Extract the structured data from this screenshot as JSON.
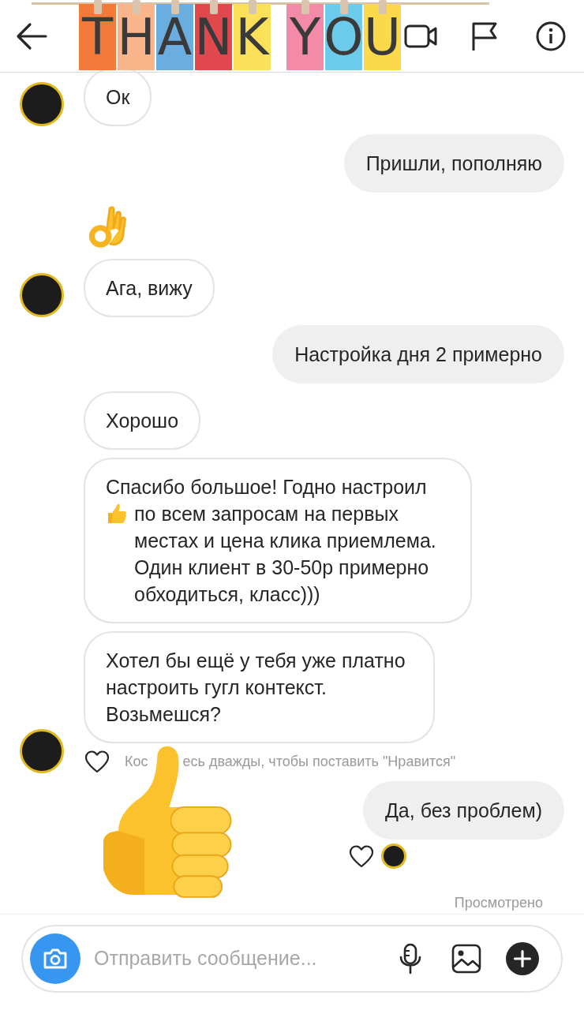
{
  "header": {
    "banner": {
      "letters": [
        {
          "char": "T",
          "color": "#f47a3a"
        },
        {
          "char": "H",
          "color": "#fbb58a"
        },
        {
          "char": "A",
          "color": "#6aaee0"
        },
        {
          "char": "N",
          "color": "#e0484e"
        },
        {
          "char": "K",
          "color": "#fbe15a"
        },
        {
          "char": "Y",
          "color": "#f38aa8"
        },
        {
          "char": "O",
          "color": "#6ccaeb"
        },
        {
          "char": "U",
          "color": "#fbd94a"
        }
      ]
    }
  },
  "messages": [
    {
      "kind": "text",
      "outgoing": false,
      "avatar": true,
      "text": "Ок"
    },
    {
      "kind": "text",
      "outgoing": true,
      "text": "Пришли, пополняю"
    },
    {
      "kind": "ok_hand",
      "outgoing": false,
      "avatar": false
    },
    {
      "kind": "text",
      "outgoing": false,
      "avatar": true,
      "text": "Ага, вижу"
    },
    {
      "kind": "text",
      "outgoing": true,
      "text": "Настройка дня 2 примерно"
    },
    {
      "kind": "text",
      "outgoing": false,
      "avatar": false,
      "text": "Хорошо"
    },
    {
      "kind": "text_with_emoji",
      "outgoing": false,
      "avatar": false,
      "text": "Спасибо большое! Годно настроил",
      "text_after": "по всем запросам на первых местах и цена клика приемлема. Один клиент в 30-50р примерно обходиться, класс)))"
    },
    {
      "kind": "text",
      "outgoing": false,
      "avatar": true,
      "text": "Хотел бы ещё у тебя уже платно настроить гугл контекст. Возьмешся?",
      "liked": false,
      "like_hint": [
        "Кос",
        "есь дважды, чтобы поставить \"Нравится\""
      ]
    },
    {
      "kind": "text",
      "outgoing": true,
      "text": "Да, без проблем)",
      "liked": false,
      "seen_avatar": true
    }
  ],
  "overlay_sticker": {
    "kind": "thumbs_up"
  },
  "status": "Просмотрено",
  "composer": {
    "placeholder": "Отправить сообщение..."
  }
}
